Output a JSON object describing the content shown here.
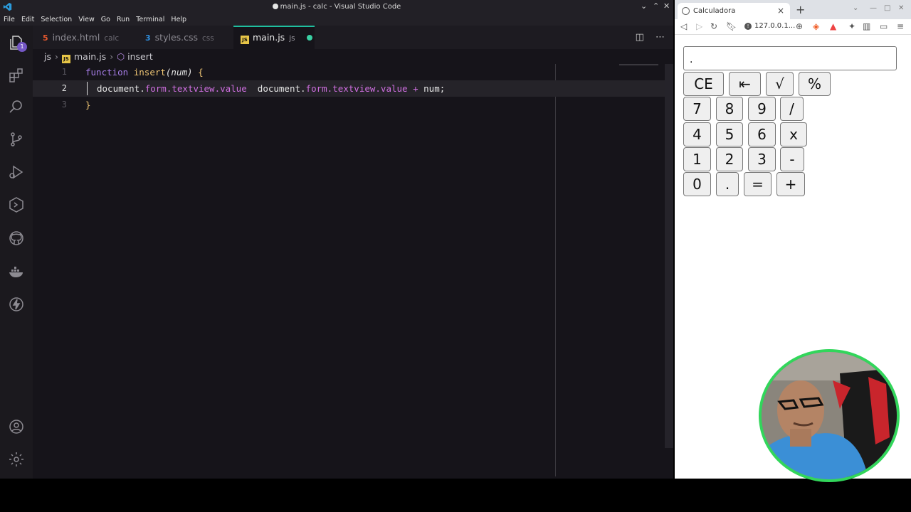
{
  "vscode": {
    "window_title": "main.js - calc - Visual Studio Code",
    "menu": [
      "File",
      "Edit",
      "Selection",
      "View",
      "Go",
      "Run",
      "Terminal",
      "Help"
    ],
    "activity_badge": "1",
    "tabs": [
      {
        "icon": "html-icon",
        "name": "index.html",
        "desc": "calc"
      },
      {
        "icon": "css-icon",
        "name": "styles.css",
        "desc": "css"
      },
      {
        "icon": "js-icon",
        "name": "main.js",
        "desc": "js",
        "active": true,
        "modified": true
      }
    ],
    "breadcrumb": {
      "folder": "js",
      "file": "main.js",
      "symbol": "insert"
    },
    "lines": [
      {
        "num": "1"
      },
      {
        "num": "2"
      },
      {
        "num": "3"
      }
    ],
    "code": {
      "l1_kw": "function",
      "l1_fn": "insert",
      "l1_param": "(num)",
      "l1_brace": "{",
      "l2_a": "document.",
      "l2_b": "form.",
      "l2_c": "textview.",
      "l2_d": "value",
      "l2_e": "  document.",
      "l2_f": "form.",
      "l2_g": "textview.",
      "l2_h": "value",
      "l2_i": " + ",
      "l2_j": "num;",
      "l3_brace": "}"
    },
    "colors": {
      "accent": "#1fbf9f",
      "badge": "#7457c4"
    }
  },
  "browser": {
    "tab_title": "Calculadora",
    "url": "127.0.0.1...",
    "display_value": ".",
    "buttons": [
      [
        "CE",
        "⇤",
        "√",
        "%"
      ],
      [
        "7",
        "8",
        "9",
        "/"
      ],
      [
        "4",
        "5",
        "6",
        "x"
      ],
      [
        "1",
        "2",
        "3",
        "-"
      ],
      [
        "0",
        ".",
        "=",
        "+"
      ]
    ]
  }
}
